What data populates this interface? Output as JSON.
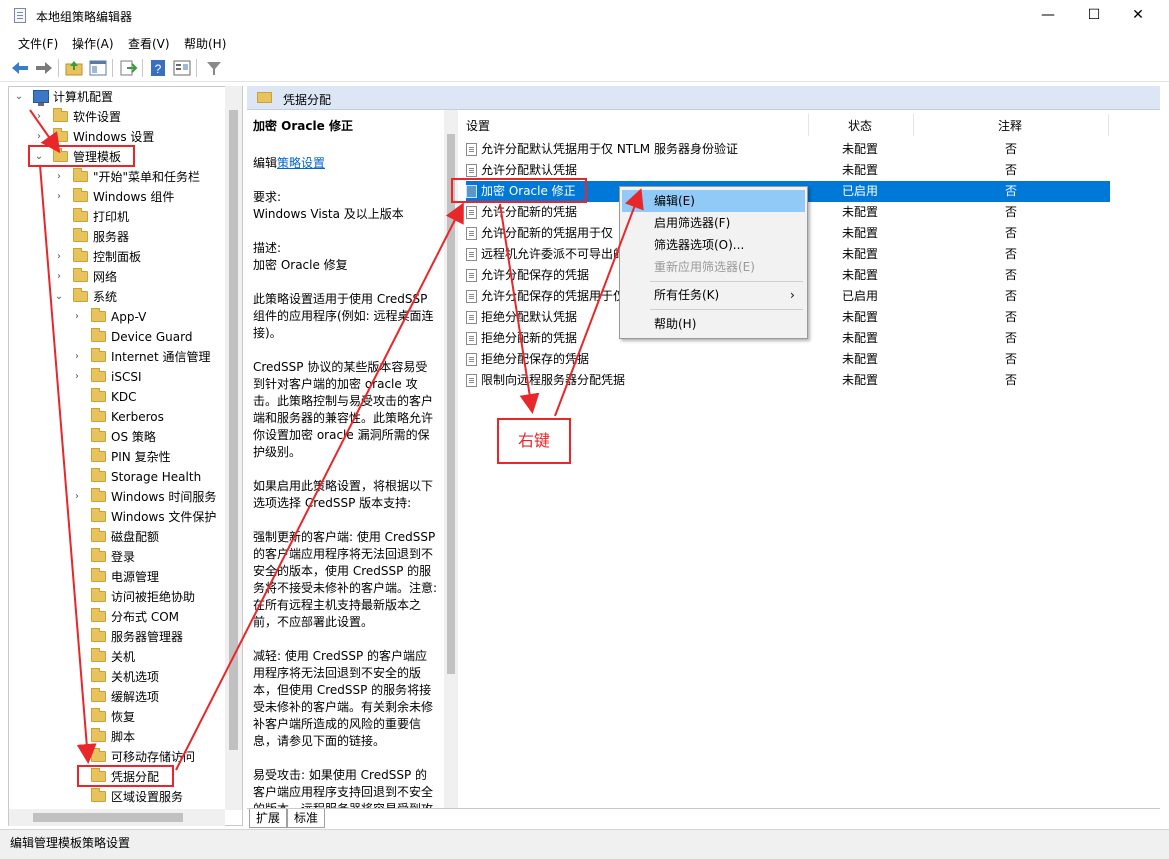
{
  "window": {
    "title": "本地组策略编辑器",
    "minimize_glyph": "—",
    "maximize_glyph": "☐",
    "close_glyph": "✕"
  },
  "menu": [
    "文件(F)",
    "操作(A)",
    "查看(V)",
    "帮助(H)"
  ],
  "toolbar_icons": [
    "back-icon",
    "forward-icon",
    "up-folder-icon",
    "show-tree-icon",
    "export-icon",
    "help-icon",
    "properties-icon",
    "filter-icon"
  ],
  "tree": {
    "root": "计算机配置",
    "items": [
      {
        "label": "软件设置"
      },
      {
        "label": "Windows 设置"
      },
      {
        "label": "管理模板"
      },
      {
        "label": "\"开始\"菜单和任务栏"
      },
      {
        "label": "Windows 组件"
      },
      {
        "label": "打印机"
      },
      {
        "label": "服务器"
      },
      {
        "label": "控制面板"
      },
      {
        "label": "网络"
      },
      {
        "label": "系统"
      },
      {
        "label": "App-V"
      },
      {
        "label": "Device Guard"
      },
      {
        "label": "Internet 通信管理"
      },
      {
        "label": "iSCSI"
      },
      {
        "label": "KDC"
      },
      {
        "label": "Kerberos"
      },
      {
        "label": "OS 策略"
      },
      {
        "label": "PIN 复杂性"
      },
      {
        "label": "Storage Health"
      },
      {
        "label": "Windows 时间服务"
      },
      {
        "label": "Windows 文件保护"
      },
      {
        "label": "磁盘配额"
      },
      {
        "label": "登录"
      },
      {
        "label": "电源管理"
      },
      {
        "label": "访问被拒绝协助"
      },
      {
        "label": "分布式 COM"
      },
      {
        "label": "服务器管理器"
      },
      {
        "label": "关机"
      },
      {
        "label": "关机选项"
      },
      {
        "label": "缓解选项"
      },
      {
        "label": "恢复"
      },
      {
        "label": "脚本"
      },
      {
        "label": "可移动存储访问"
      },
      {
        "label": "凭据分配"
      },
      {
        "label": "区域设置服务"
      }
    ]
  },
  "panel_title": "凭据分配",
  "description": {
    "heading": "加密 Oracle 修正",
    "edit_prefix": "编辑",
    "edit_link": "策略设置",
    "requirement_label": "要求:",
    "requirement": "Windows Vista 及以上版本",
    "desc_label": "描述:",
    "desc": "加密 Oracle 修复",
    "p1": "此策略设置适用于使用 CredSSP 组件的应用程序(例如: 远程桌面连接)。",
    "p2": "CredSSP 协议的某些版本容易受到针对客户端的加密 oracle 攻击。此策略控制与易受攻击的客户端和服务器的兼容性。此策略允许你设置加密 oracle 漏洞所需的保护级别。",
    "p3": "如果启用此策略设置，将根据以下选项选择 CredSSP 版本支持:",
    "p4": "强制更新的客户端: 使用 CredSSP 的客户端应用程序将无法回退到不安全的版本，使用 CredSSP 的服务将不接受未修补的客户端。注意: 在所有远程主机支持最新版本之前，不应部署此设置。",
    "p5": "减轻: 使用 CredSSP 的客户端应用程序将无法回退到不安全的版本，但使用 CredSSP 的服务将接受未修补的客户端。有关剩余未修补客户端所造成的风险的重要信息，请参见下面的链接。",
    "p6": "易受攻击: 如果使用 CredSSP 的客户端应用程序支持回退到不安全的版本，远程服务器将容易受到攻击。"
  },
  "columns": {
    "setting": "设置",
    "state": "状态",
    "note": "注释"
  },
  "rows": [
    {
      "name": "允许分配默认凭据用于仅 NTLM 服务器身份验证",
      "state": "未配置",
      "note": "否"
    },
    {
      "name": "允许分配默认凭据",
      "state": "未配置",
      "note": "否"
    },
    {
      "name": "加密 Oracle 修正",
      "state": "已启用",
      "note": "否"
    },
    {
      "name": "允许分配新的凭据",
      "state": "未配置",
      "note": "否"
    },
    {
      "name": "允许分配新的凭据用于仅",
      "state": "未配置",
      "note": "否"
    },
    {
      "name": "远程机允许委派不可导出的",
      "state": "未配置",
      "note": "否"
    },
    {
      "name": "允许分配保存的凭据",
      "state": "未配置",
      "note": "否"
    },
    {
      "name": "允许分配保存的凭据用于仅",
      "state": "已启用",
      "note": "否"
    },
    {
      "name": "拒绝分配默认凭据",
      "state": "未配置",
      "note": "否"
    },
    {
      "name": "拒绝分配新的凭据",
      "state": "未配置",
      "note": "否"
    },
    {
      "name": "拒绝分配保存的凭据",
      "state": "未配置",
      "note": "否"
    },
    {
      "name": "限制向远程服务器分配凭据",
      "state": "未配置",
      "note": "否"
    }
  ],
  "context_menu": {
    "edit": "编辑(E)",
    "enable_filter": "启用筛选器(F)",
    "filter_options": "筛选器选项(O)...",
    "reapply_filter": "重新应用筛选器(E)",
    "all_tasks": "所有任务(K)",
    "submenu_glyph": "›",
    "help": "帮助(H)"
  },
  "tabs": [
    "扩展",
    "标准"
  ],
  "status": "编辑管理模板策略设置",
  "annotation": {
    "label": "右键",
    "color": "#e8272a"
  }
}
